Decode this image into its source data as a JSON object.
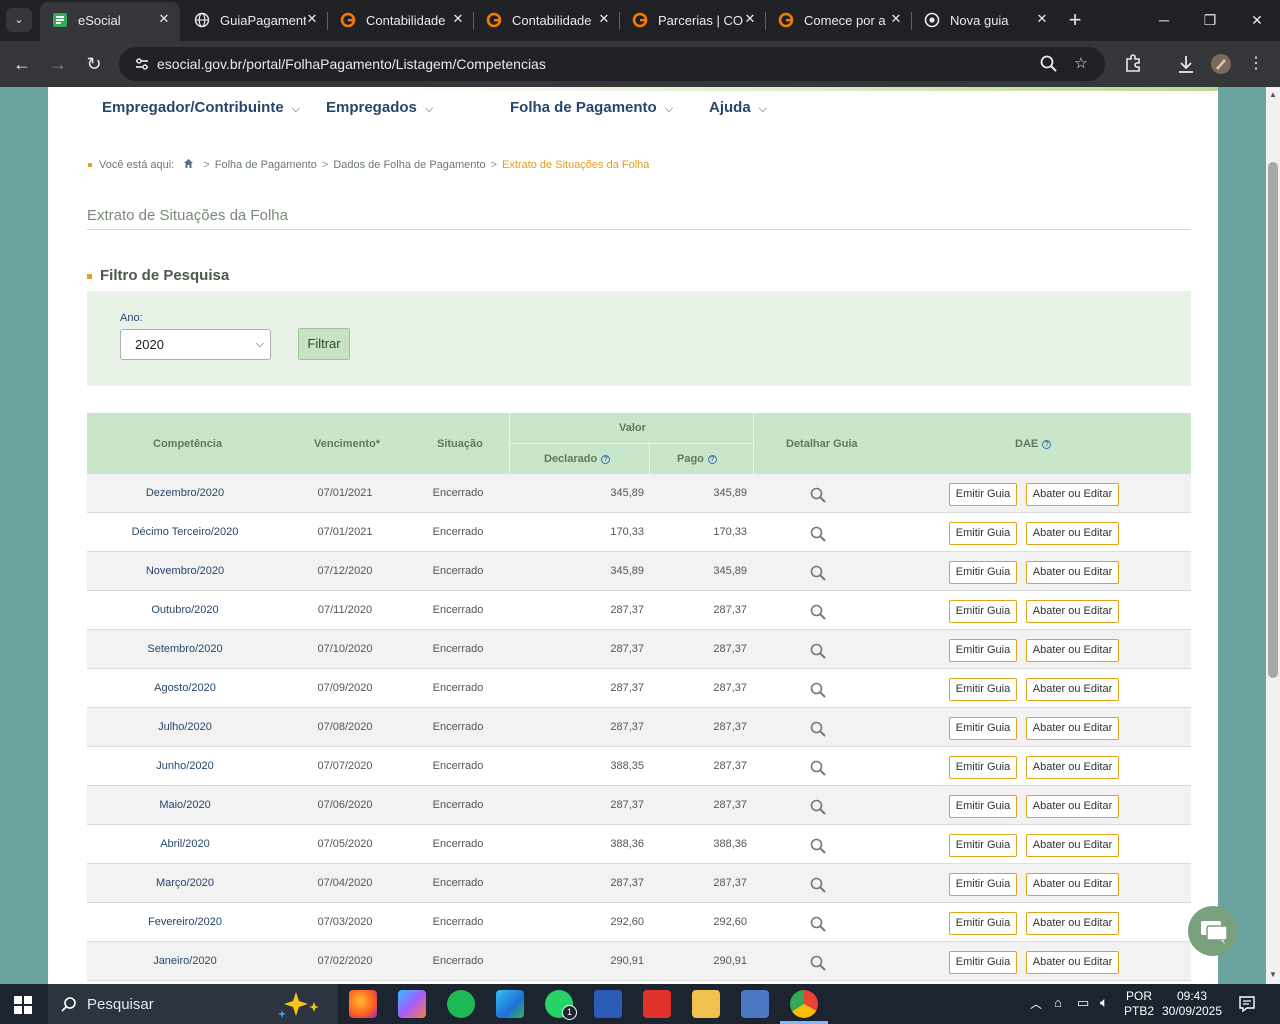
{
  "browser": {
    "tab_list_glyph": "⌄",
    "tabs": [
      {
        "title": "eSocial",
        "icon": "esocial-icon"
      },
      {
        "title": "GuiaPagamento",
        "icon": "globe-icon"
      },
      {
        "title": "Contabilidade",
        "icon": "contabilidade-icon"
      },
      {
        "title": "Contabilidade",
        "icon": "contabilidade-icon"
      },
      {
        "title": "Parcerias | CO",
        "icon": "contabilidade-icon"
      },
      {
        "title": "Comece por a",
        "icon": "contabilidade-icon"
      },
      {
        "title": "Nova guia",
        "icon": "chrome-icon"
      }
    ],
    "url": "esocial.gov.br/portal/FolhaPagamento/Listagem/Competencias"
  },
  "nav": {
    "menus": [
      {
        "label": "Empregador/Contribuinte"
      },
      {
        "label": "Empregados"
      },
      {
        "label": "Folha de Pagamento"
      },
      {
        "label": "Ajuda"
      }
    ]
  },
  "breadcrumb": {
    "prefix": "Você está aqui:",
    "items": [
      "Folha de Pagamento",
      "Dados de Folha de Pagamento"
    ],
    "current": "Extrato de Situações da Folha"
  },
  "page_title": "Extrato de Situações da Folha",
  "filter": {
    "heading": "Filtro de Pesquisa",
    "ano_label": "Ano:",
    "ano_value": "2020",
    "button": "Filtrar"
  },
  "table": {
    "headers": {
      "competencia": "Competência",
      "vencimento": "Vencimento*",
      "situacao": "Situação",
      "valor": "Valor",
      "declarado": "Declarado",
      "pago": "Pago",
      "detalhar": "Detalhar Guia",
      "dae": "DAE",
      "help_glyph": "?"
    },
    "rows": [
      {
        "competencia": "Dezembro/2020",
        "vencimento": "07/01/2021",
        "situacao": "Encerrado",
        "declarado": "345,89",
        "pago": "345,89",
        "emitir": "Emitir Guia",
        "abater": "Abater ou Editar"
      },
      {
        "competencia": "Décimo Terceiro/2020",
        "vencimento": "07/01/2021",
        "situacao": "Encerrado",
        "declarado": "170,33",
        "pago": "170,33",
        "emitir": "Emitir Guia",
        "abater": "Abater ou Editar"
      },
      {
        "competencia": "Novembro/2020",
        "vencimento": "07/12/2020",
        "situacao": "Encerrado",
        "declarado": "345,89",
        "pago": "345,89",
        "emitir": "Emitir Guia",
        "abater": "Abater ou Editar"
      },
      {
        "competencia": "Outubro/2020",
        "vencimento": "07/11/2020",
        "situacao": "Encerrado",
        "declarado": "287,37",
        "pago": "287,37",
        "emitir": "Emitir Guia",
        "abater": "Abater ou Editar"
      },
      {
        "competencia": "Setembro/2020",
        "vencimento": "07/10/2020",
        "situacao": "Encerrado",
        "declarado": "287,37",
        "pago": "287,37",
        "emitir": "Emitir Guia",
        "abater": "Abater ou Editar"
      },
      {
        "competencia": "Agosto/2020",
        "vencimento": "07/09/2020",
        "situacao": "Encerrado",
        "declarado": "287,37",
        "pago": "287,37",
        "emitir": "Emitir Guia",
        "abater": "Abater ou Editar"
      },
      {
        "competencia": "Julho/2020",
        "vencimento": "07/08/2020",
        "situacao": "Encerrado",
        "declarado": "287,37",
        "pago": "287,37",
        "emitir": "Emitir Guia",
        "abater": "Abater ou Editar"
      },
      {
        "competencia": "Junho/2020",
        "vencimento": "07/07/2020",
        "situacao": "Encerrado",
        "declarado": "388,35",
        "pago": "287,37",
        "emitir": "Emitir Guia",
        "abater": "Abater ou Editar"
      },
      {
        "competencia": "Maio/2020",
        "vencimento": "07/06/2020",
        "situacao": "Encerrado",
        "declarado": "287,37",
        "pago": "287,37",
        "emitir": "Emitir Guia",
        "abater": "Abater ou Editar"
      },
      {
        "competencia": "Abril/2020",
        "vencimento": "07/05/2020",
        "situacao": "Encerrado",
        "declarado": "388,36",
        "pago": "388,36",
        "emitir": "Emitir Guia",
        "abater": "Abater ou Editar"
      },
      {
        "competencia": "Março/2020",
        "vencimento": "07/04/2020",
        "situacao": "Encerrado",
        "declarado": "287,37",
        "pago": "287,37",
        "emitir": "Emitir Guia",
        "abater": "Abater ou Editar"
      },
      {
        "competencia": "Fevereiro/2020",
        "vencimento": "07/03/2020",
        "situacao": "Encerrado",
        "declarado": "292,60",
        "pago": "292,60",
        "emitir": "Emitir Guia",
        "abater": "Abater ou Editar"
      },
      {
        "competencia": "Janeiro/2020",
        "vencimento": "07/02/2020",
        "situacao": "Encerrado",
        "declarado": "290,91",
        "pago": "290,91",
        "emitir": "Emitir Guia",
        "abater": "Abater ou Editar"
      }
    ]
  },
  "taskbar": {
    "search_placeholder": "Pesquisar",
    "whatsapp_badge": "1",
    "lang_line1": "POR",
    "lang_line2": "PTB2",
    "time": "09:43",
    "date": "30/09/2025"
  },
  "colors": {
    "accent_orange": "#e0a31a",
    "table_header_green": "#c8e6c9",
    "filter_box_green": "#e8f2e7",
    "link_blue": "#26476b"
  }
}
